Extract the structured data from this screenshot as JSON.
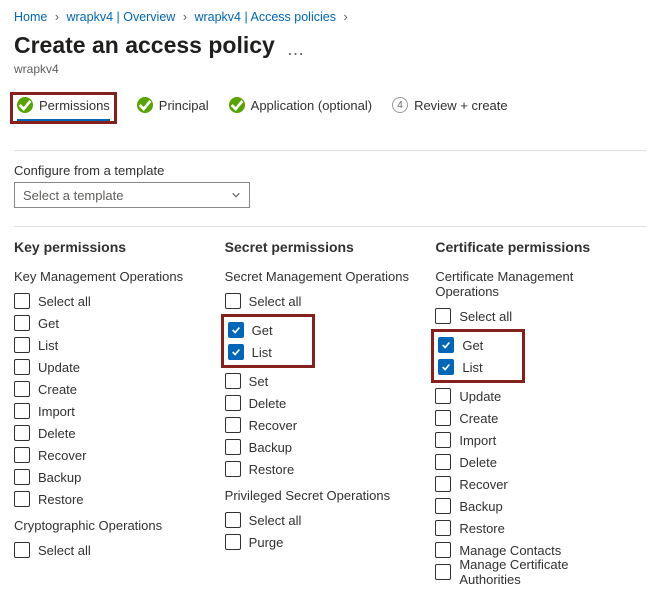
{
  "breadcrumb": {
    "home": "Home",
    "overview": "wrapkv4 | Overview",
    "policies": "wrapkv4 | Access policies"
  },
  "page_title": "Create an access policy",
  "resource_name": "wrapkv4",
  "steps": {
    "permissions": "Permissions",
    "principal": "Principal",
    "application": "Application (optional)",
    "review_num": "4",
    "review": "Review + create"
  },
  "template": {
    "label": "Configure from a template",
    "placeholder": "Select a template"
  },
  "col_headers": {
    "key": "Key permissions",
    "secret": "Secret permissions",
    "cert": "Certificate permissions"
  },
  "subheads": {
    "key_mgmt": "Key Management Operations",
    "crypto": "Cryptographic Operations",
    "secret_mgmt": "Secret Management Operations",
    "priv_secret": "Privileged Secret Operations",
    "cert_mgmt": "Certificate Management Operations"
  },
  "labels": {
    "select_all": "Select all",
    "get": "Get",
    "list": "List",
    "update": "Update",
    "create": "Create",
    "import": "Import",
    "delete": "Delete",
    "recover": "Recover",
    "backup": "Backup",
    "restore": "Restore",
    "set": "Set",
    "purge": "Purge",
    "manage_contacts": "Manage Contacts",
    "manage_ca": "Manage Certificate Authorities"
  }
}
